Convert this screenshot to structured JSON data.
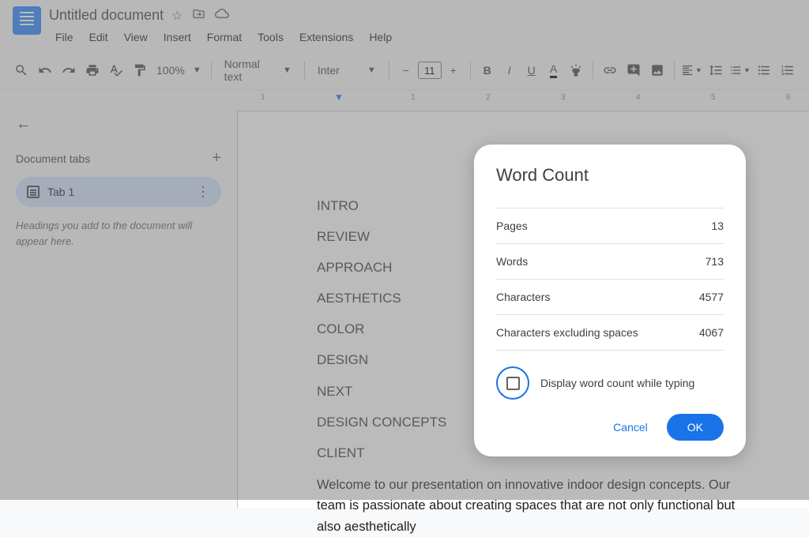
{
  "header": {
    "title": "Untitled document"
  },
  "menu": [
    "File",
    "Edit",
    "View",
    "Insert",
    "Format",
    "Tools",
    "Extensions",
    "Help"
  ],
  "toolbar": {
    "zoom": "100%",
    "style": "Normal text",
    "font": "Inter",
    "font_size": "11"
  },
  "ruler": {
    "marks": [
      "1",
      "1",
      "2",
      "3",
      "4",
      "5",
      "6"
    ]
  },
  "sidebar": {
    "title": "Document tabs",
    "tab": "Tab 1",
    "hint": "Headings you add to the document will appear here."
  },
  "doc": {
    "headings": [
      "INTRO",
      "REVIEW",
      "APPROACH",
      "AESTHETICS",
      "COLOR",
      "DESIGN",
      "NEXT",
      "DESIGN CONCEPTS",
      "CLIENT"
    ],
    "para": "Welcome to our presentation on innovative indoor design concepts. Our team is passionate about creating spaces that are not only functional but also aesthetically"
  },
  "modal": {
    "title": "Word Count",
    "stats": [
      {
        "label": "Pages",
        "value": "13"
      },
      {
        "label": "Words",
        "value": "713"
      },
      {
        "label": "Characters",
        "value": "4577"
      },
      {
        "label": "Characters excluding spaces",
        "value": "4067"
      }
    ],
    "checkbox_label": "Display word count while typing",
    "cancel": "Cancel",
    "ok": "OK"
  }
}
